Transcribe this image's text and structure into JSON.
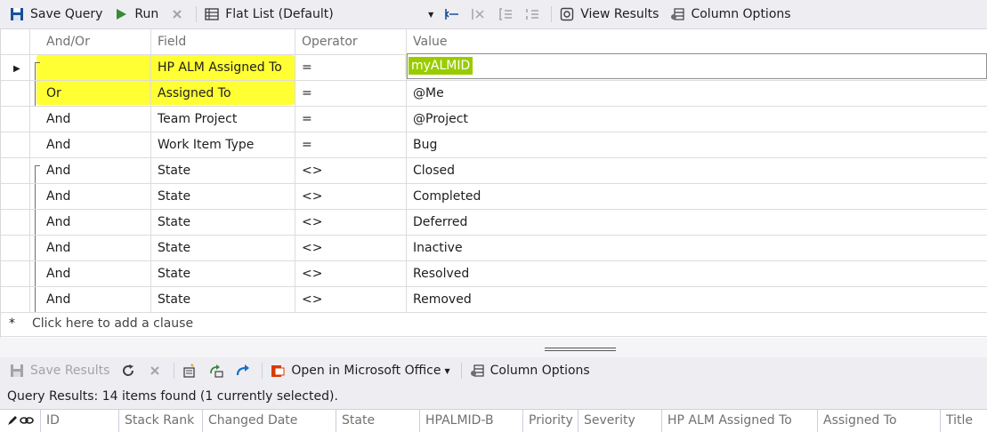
{
  "toolbar": {
    "save_query": "Save Query",
    "run": "Run",
    "view_type": "Flat List (Default)",
    "view_results": "View Results",
    "column_options": "Column Options"
  },
  "grid": {
    "headers": {
      "and_or": "And/Or",
      "field": "Field",
      "operator": "Operator",
      "value": "Value"
    },
    "rows": [
      {
        "and_or": "",
        "field": "HP ALM Assigned To",
        "operator": "=",
        "value": "myALMID"
      },
      {
        "and_or": "Or",
        "field": "Assigned To",
        "operator": "=",
        "value": "@Me"
      },
      {
        "and_or": "And",
        "field": "Team Project",
        "operator": "=",
        "value": "@Project"
      },
      {
        "and_or": "And",
        "field": "Work Item Type",
        "operator": "=",
        "value": "Bug"
      },
      {
        "and_or": "And",
        "field": "State",
        "operator": "<>",
        "value": "Closed"
      },
      {
        "and_or": "And",
        "field": "State",
        "operator": "<>",
        "value": "Completed"
      },
      {
        "and_or": "And",
        "field": "State",
        "operator": "<>",
        "value": "Deferred"
      },
      {
        "and_or": "And",
        "field": "State",
        "operator": "<>",
        "value": "Inactive"
      },
      {
        "and_or": "And",
        "field": "State",
        "operator": "<>",
        "value": "Resolved"
      },
      {
        "and_or": "And",
        "field": "State",
        "operator": "<>",
        "value": "Removed"
      }
    ],
    "add_marker": "*",
    "add_clause": "Click here to add a clause",
    "highlight_color": "#ffff33",
    "selection_color": "#99cc00"
  },
  "results_toolbar": {
    "save_results": "Save Results",
    "open_in_office": "Open in Microsoft Office",
    "column_options": "Column Options"
  },
  "status": "Query Results: 14 items found (1 currently selected).",
  "results_columns": [
    "ID",
    "Stack Rank",
    "Changed Date",
    "State",
    "HPALMID-B",
    "Priority",
    "Severity",
    "HP ALM Assigned To",
    "Assigned To",
    "Title"
  ]
}
